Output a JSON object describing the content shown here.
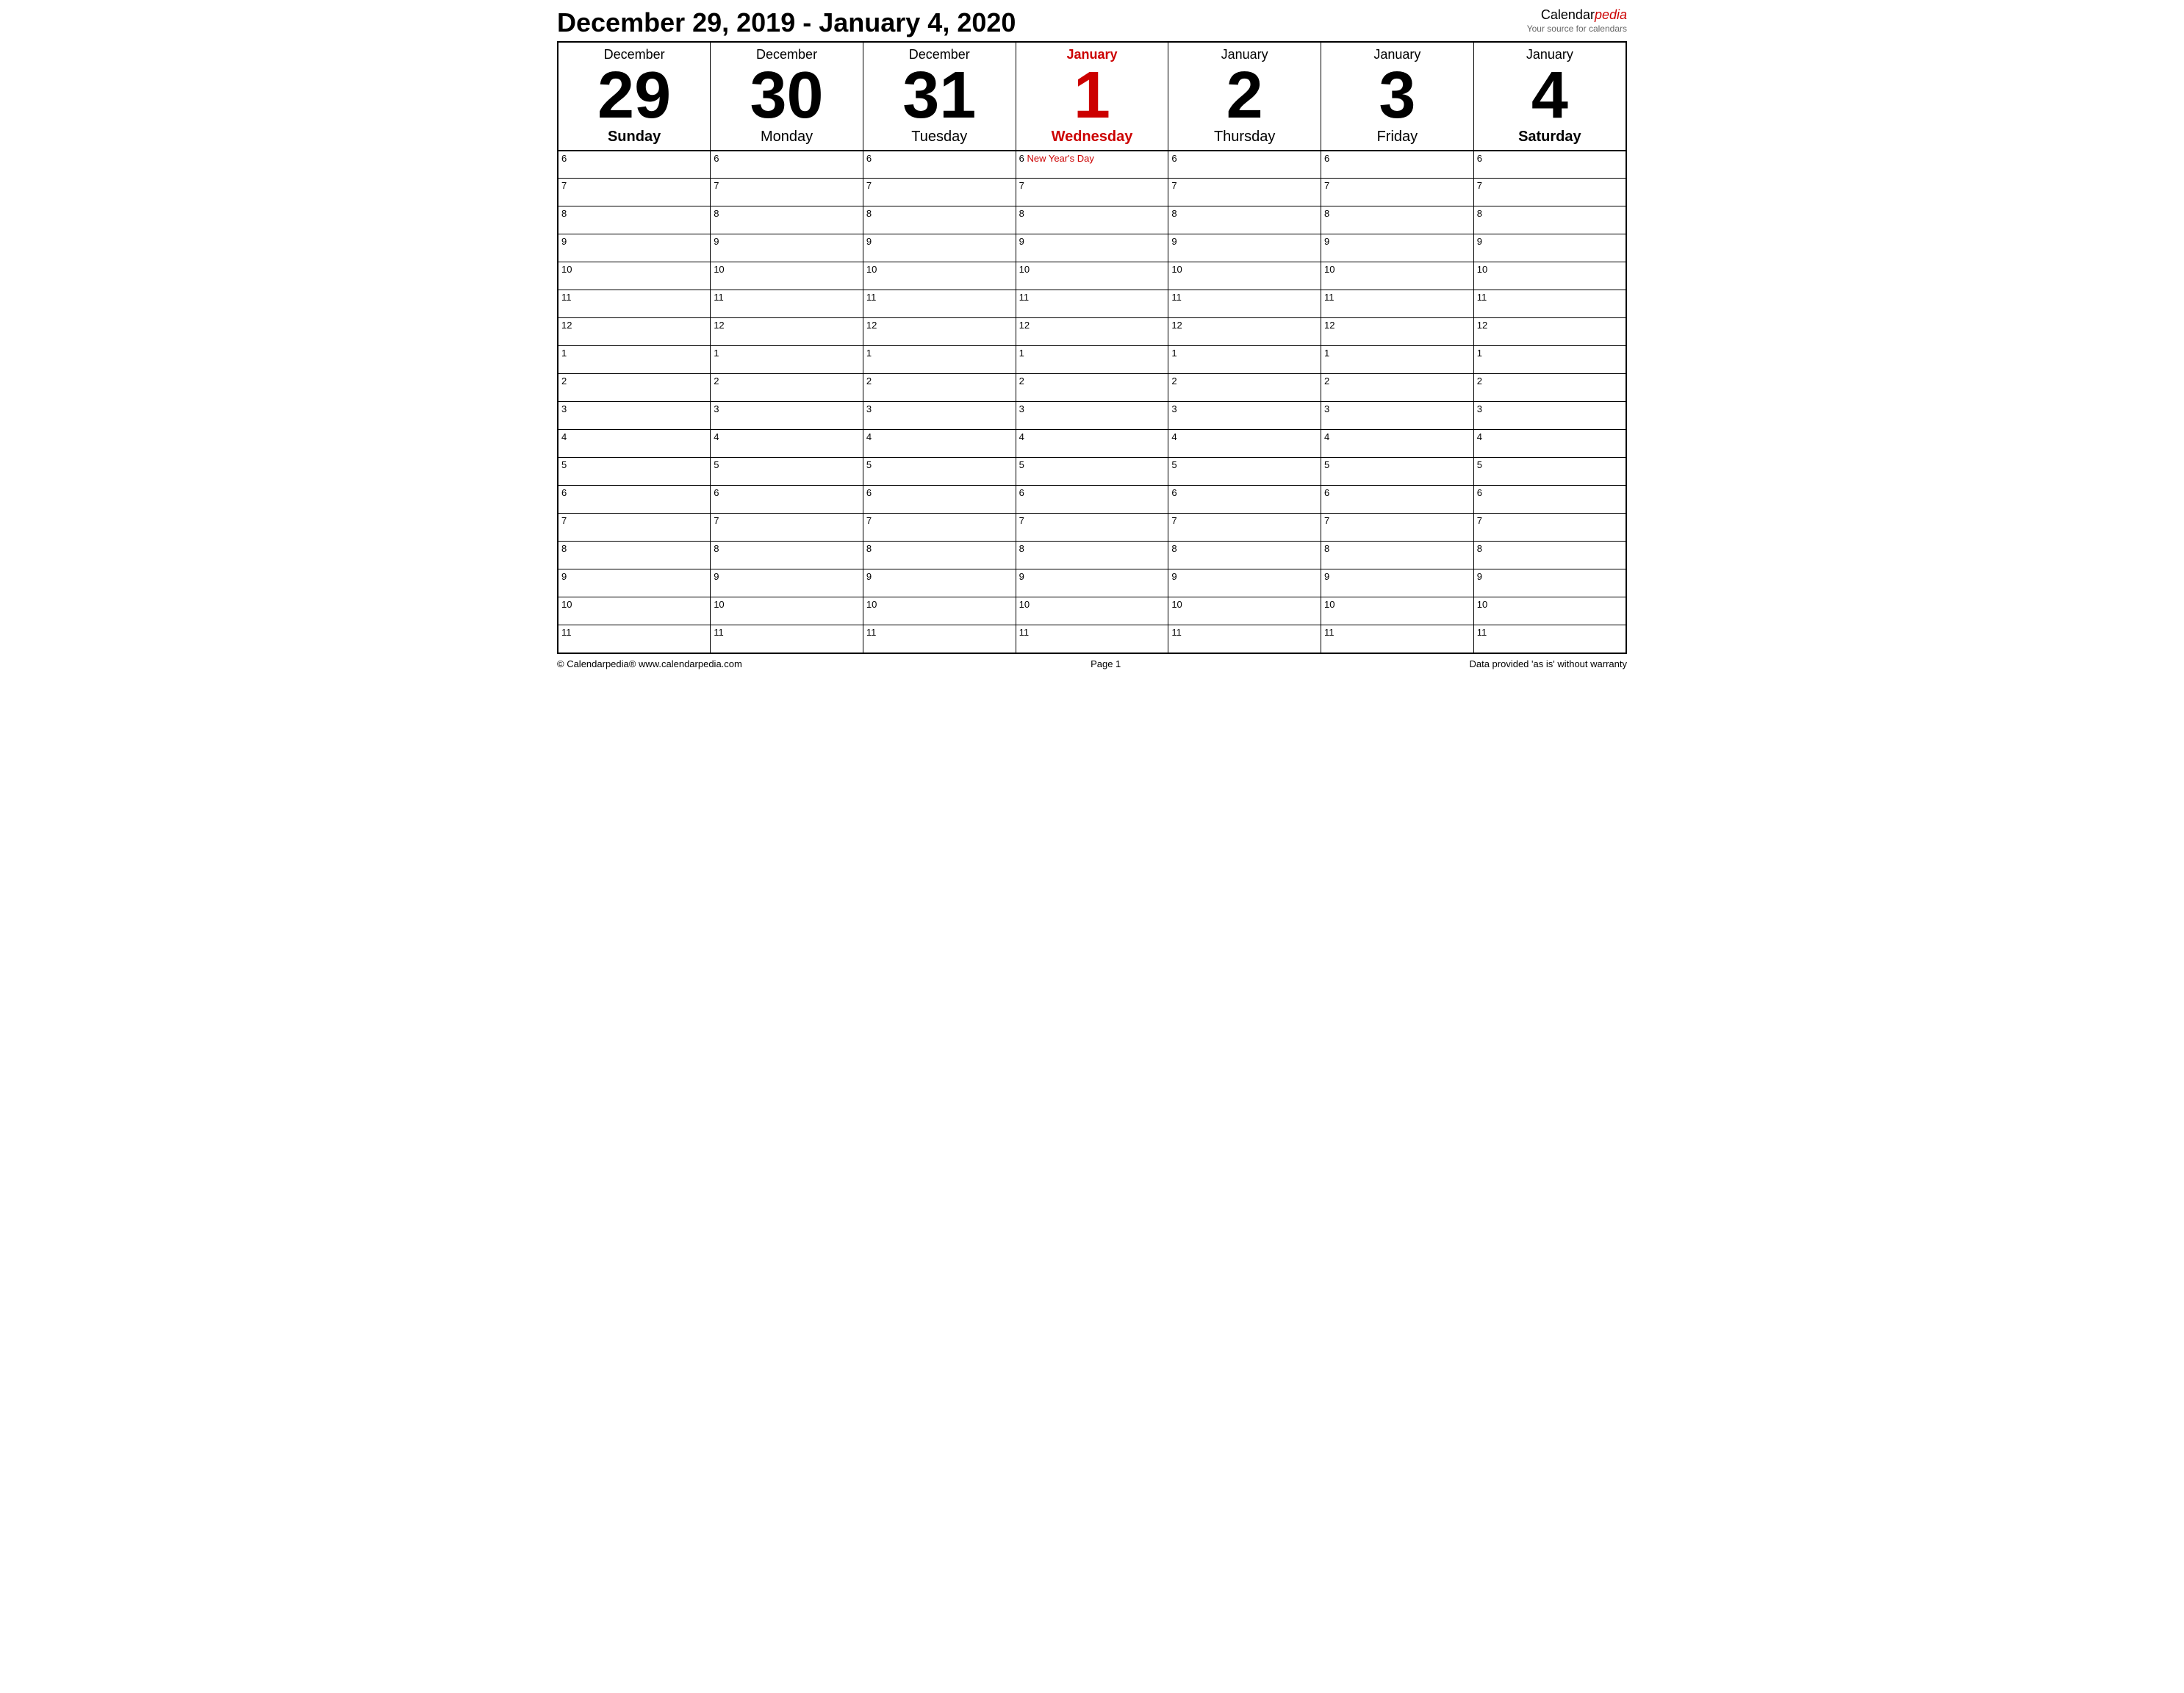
{
  "header": {
    "title": "December 29, 2019 - January 4, 2020",
    "logo_name": "Calendar",
    "logo_pedia": "pedia",
    "logo_subtitle": "Your source for calendars"
  },
  "days": [
    {
      "month": "December",
      "month_red": false,
      "number": "29",
      "number_red": false,
      "day_name": "Sunday",
      "day_name_bold": true,
      "day_name_red": false
    },
    {
      "month": "December",
      "month_red": false,
      "number": "30",
      "number_red": false,
      "day_name": "Monday",
      "day_name_bold": false,
      "day_name_red": false
    },
    {
      "month": "December",
      "month_red": false,
      "number": "31",
      "number_red": false,
      "day_name": "Tuesday",
      "day_name_bold": false,
      "day_name_red": false
    },
    {
      "month": "January",
      "month_red": true,
      "number": "1",
      "number_red": true,
      "day_name": "Wednesday",
      "day_name_bold": true,
      "day_name_red": true
    },
    {
      "month": "January",
      "month_red": false,
      "number": "2",
      "number_red": false,
      "day_name": "Thursday",
      "day_name_bold": false,
      "day_name_red": false
    },
    {
      "month": "January",
      "month_red": false,
      "number": "3",
      "number_red": false,
      "day_name": "Friday",
      "day_name_bold": false,
      "day_name_red": false
    },
    {
      "month": "January",
      "month_red": false,
      "number": "4",
      "number_red": false,
      "day_name": "Saturday",
      "day_name_bold": true,
      "day_name_red": false
    }
  ],
  "time_slots": [
    {
      "label": "6",
      "holiday": "New Year's Day",
      "holiday_col": 3
    },
    {
      "label": "7",
      "holiday": null
    },
    {
      "label": "8",
      "holiday": null
    },
    {
      "label": "9",
      "holiday": null
    },
    {
      "label": "10",
      "holiday": null
    },
    {
      "label": "11",
      "holiday": null
    },
    {
      "label": "12",
      "holiday": null
    },
    {
      "label": "1",
      "holiday": null
    },
    {
      "label": "2",
      "holiday": null
    },
    {
      "label": "3",
      "holiday": null
    },
    {
      "label": "4",
      "holiday": null
    },
    {
      "label": "5",
      "holiday": null
    },
    {
      "label": "6",
      "holiday": null
    },
    {
      "label": "7",
      "holiday": null
    },
    {
      "label": "8",
      "holiday": null
    },
    {
      "label": "9",
      "holiday": null
    },
    {
      "label": "10",
      "holiday": null
    },
    {
      "label": "11",
      "holiday": null
    }
  ],
  "footer": {
    "left": "© Calendarpedia®   www.calendarpedia.com",
    "center": "Page 1",
    "right": "Data provided 'as is' without warranty"
  }
}
